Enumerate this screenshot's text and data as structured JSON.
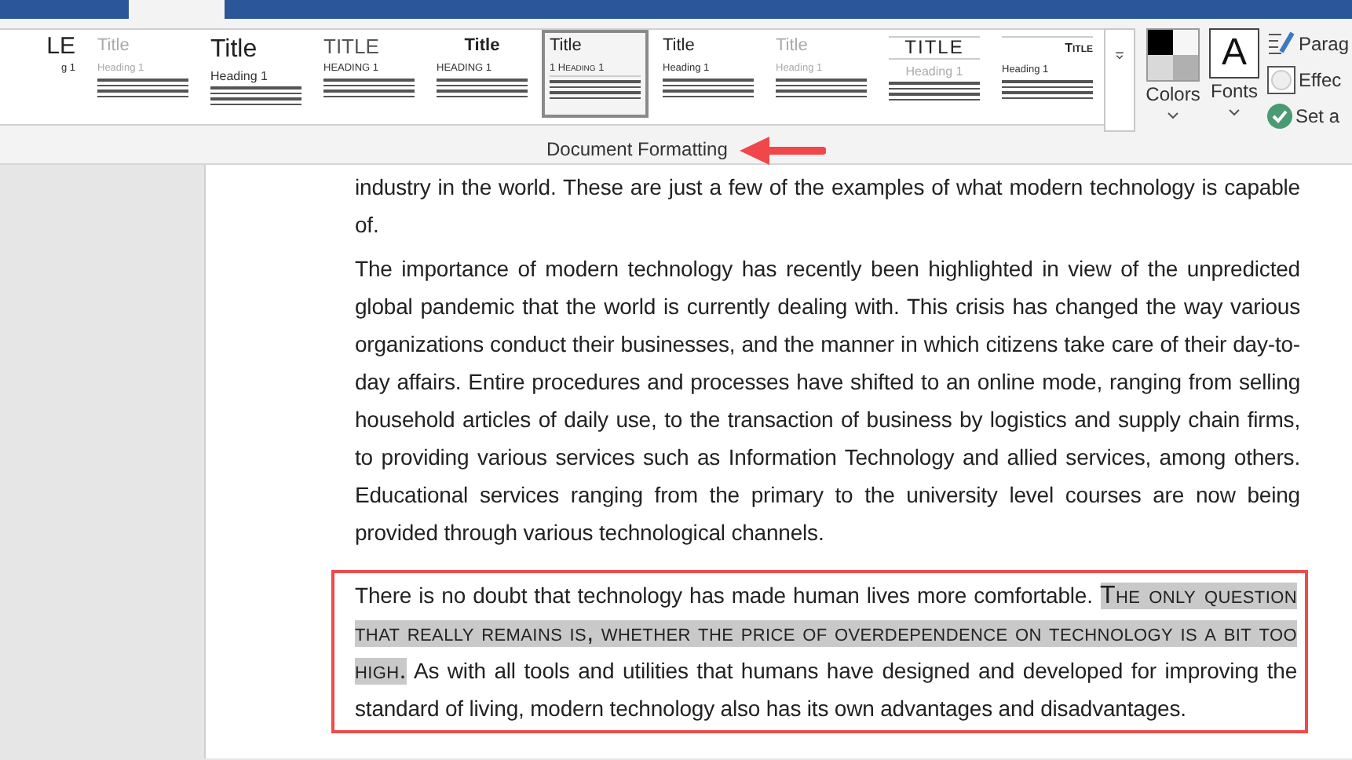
{
  "gallery": {
    "styles": [
      {
        "title": "LE",
        "heading": "g 1",
        "kind": "cut",
        "selected": false
      },
      {
        "title": "Title",
        "heading": "Heading 1",
        "kind": "faded",
        "selected": false
      },
      {
        "title": "Title",
        "heading": "Heading 1",
        "kind": "large",
        "selected": false
      },
      {
        "title": "TITLE",
        "heading": "HEADING 1",
        "kind": "caps",
        "selected": false
      },
      {
        "title": "Title",
        "heading": "HEADING 1",
        "kind": "centered",
        "selected": false
      },
      {
        "title": "Title",
        "heading": "1 Heading 1",
        "kind": "numbered",
        "selected": true
      },
      {
        "title": "Title",
        "heading": "Heading 1",
        "kind": "plain",
        "selected": false
      },
      {
        "title": "Title",
        "heading": "Heading 1",
        "kind": "faded",
        "selected": false
      },
      {
        "title": "TITLE",
        "heading": "Heading 1",
        "kind": "lined",
        "selected": false
      },
      {
        "title": "Title",
        "heading": "Heading 1",
        "kind": "right",
        "selected": false
      }
    ]
  },
  "theme": {
    "colors_label": "Colors",
    "fonts_label": "Fonts",
    "fonts_glyph": "A"
  },
  "side_options": [
    {
      "kind": "paragraph",
      "label": "Parag"
    },
    {
      "kind": "effects",
      "label": "Effec"
    },
    {
      "kind": "default",
      "label": "Set a"
    }
  ],
  "group_label": "Document Formatting",
  "document": {
    "paragraphs": [
      {
        "boxed": false,
        "segments": [
          {
            "text": "industry in the world. These are just a few of the examples of what modern technology is capable of.",
            "highlighted": false
          }
        ]
      },
      {
        "boxed": false,
        "segments": [
          {
            "text": "The importance of modern technology has recently been highlighted in view of the unpredicted global pandemic that the world is currently dealing with. This crisis has changed the way various organizations conduct their businesses, and the manner in which citizens take care of their day-to-day affairs. Entire procedures and processes have shifted to an online mode, ranging from selling household articles of daily use, to the transaction of business by logistics and supply chain firms, to providing various services such as Information Technology and allied services, among others. Educational services ranging from the primary to the university level courses are now being provided through various technological channels.",
            "highlighted": false
          }
        ]
      },
      {
        "boxed": true,
        "segments": [
          {
            "text": "There is no doubt that technology has made human lives more comfortable. ",
            "highlighted": false
          },
          {
            "text": "The only question that really remains is, whether the price of overdependence on technology is a bit too high.",
            "highlighted": true
          },
          {
            "text": " As with all tools and utilities that humans have designed and developed for improving the standard of living, modern technology also has its own advantages and disadvantages.",
            "highlighted": false
          }
        ]
      }
    ]
  }
}
